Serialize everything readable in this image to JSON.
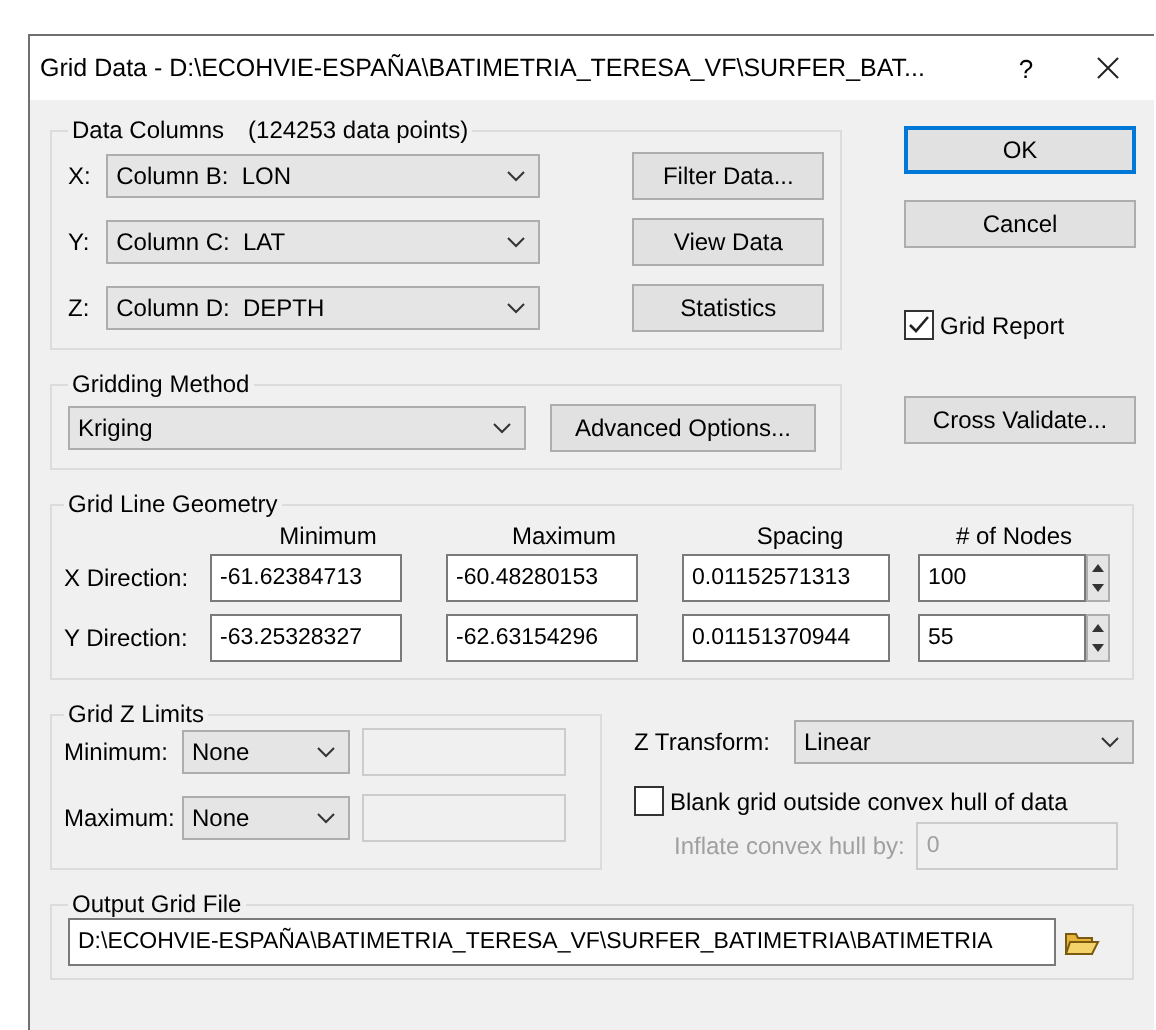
{
  "window": {
    "title": "Grid Data - D:\\ECOHVIE-ESPAÑA\\BATIMETRIA_TERESA_VF\\SURFER_BAT...",
    "help": "?"
  },
  "data_columns": {
    "title": "Data Columns",
    "count": "(124253 data points)",
    "rows": [
      {
        "axis": "X:",
        "value": "Column B:  LON",
        "button": "Filter Data..."
      },
      {
        "axis": "Y:",
        "value": "Column C:  LAT",
        "button": "View Data"
      },
      {
        "axis": "Z:",
        "value": "Column D:  DEPTH",
        "button": "Statistics"
      }
    ]
  },
  "dialog_buttons": [
    {
      "label": "OK",
      "default": true
    },
    {
      "label": "Cancel",
      "default": false
    }
  ],
  "grid_report": {
    "label": "Grid Report",
    "checked": true
  },
  "gridding_method": {
    "title": "Gridding Method",
    "value": "Kriging",
    "advanced_button": "Advanced Options...",
    "cross_validate_button": "Cross Validate..."
  },
  "geometry": {
    "title": "Grid Line Geometry",
    "columns": [
      "Minimum",
      "Maximum",
      "Spacing",
      "# of Nodes"
    ],
    "rows": [
      {
        "label": "X Direction:",
        "values": [
          "-61.62384713",
          "-60.48280153",
          "0.01152571313"
        ],
        "nodes": "100"
      },
      {
        "label": "Y Direction:",
        "values": [
          "-63.25328327",
          "-62.63154296",
          "0.01151370944"
        ],
        "nodes": "55"
      }
    ]
  },
  "z_limits": {
    "title": "Grid Z Limits",
    "rows": [
      {
        "label": "Minimum:",
        "value": "None",
        "field_disabled": true
      },
      {
        "label": "Maximum:",
        "value": "None",
        "field_disabled": true
      }
    ]
  },
  "z_transform": {
    "label": "Z Transform:",
    "value": "Linear"
  },
  "blank_grid": {
    "label": "Blank grid outside convex hull of data",
    "checked": false
  },
  "inflate": {
    "label": "Inflate convex hull by:",
    "value": "0",
    "disabled": true
  },
  "output": {
    "title": "Output Grid File",
    "path": "D:\\ECOHVIE-ESPAÑA\\BATIMETRIA_TERESA_VF\\SURFER_BATIMETRIA\\BATIMETRIA"
  }
}
